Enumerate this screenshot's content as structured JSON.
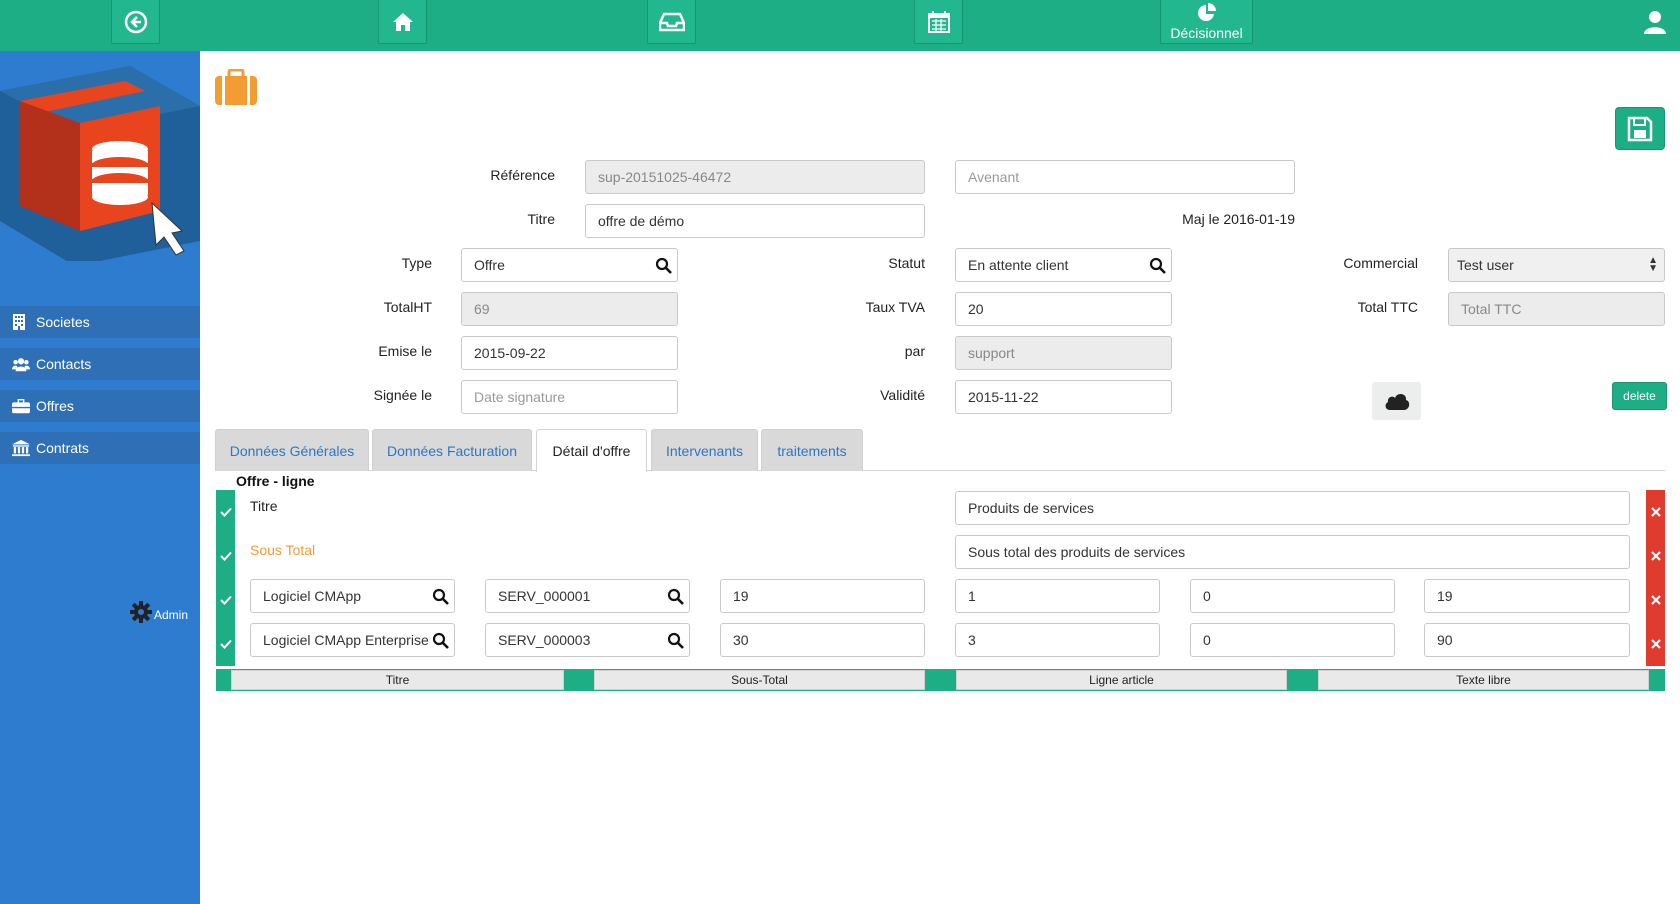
{
  "topbar": {
    "decisionnel_label": "Décisionnel"
  },
  "sidebar": {
    "items": [
      {
        "label": "Societes",
        "icon": "building-icon"
      },
      {
        "label": "Contacts",
        "icon": "users-icon"
      },
      {
        "label": "Offres",
        "icon": "briefcase-icon"
      },
      {
        "label": "Contrats",
        "icon": "bank-icon"
      }
    ],
    "admin_label": "Admin"
  },
  "form": {
    "reference": {
      "label": "Référence",
      "value": "sup-20151025-46472"
    },
    "avenant": {
      "placeholder": "Avenant"
    },
    "titre": {
      "label": "Titre",
      "value": "offre de démo"
    },
    "maj": "Maj le 2016-01-19",
    "type": {
      "label": "Type",
      "value": "Offre"
    },
    "statut": {
      "label": "Statut",
      "value": "En attente client"
    },
    "commercial": {
      "label": "Commercial",
      "value": "Test user"
    },
    "total_ht": {
      "label": "TotalHT",
      "value": "69"
    },
    "taux_tva": {
      "label": "Taux TVA",
      "value": "20"
    },
    "total_ttc": {
      "label": "Total TTC",
      "placeholder": "Total TTC"
    },
    "emise_le": {
      "label": "Emise le",
      "value": "2015-09-22"
    },
    "par": {
      "label": "par",
      "value": "support"
    },
    "signee_le": {
      "label": "Signée le",
      "placeholder": "Date signature"
    },
    "validite": {
      "label": "Validité",
      "value": "2015-11-22"
    },
    "delete_label": "delete"
  },
  "tabs": [
    {
      "label": "Données Générales"
    },
    {
      "label": "Données Facturation"
    },
    {
      "label": "Détail d'offre"
    },
    {
      "label": "Intervenants"
    },
    {
      "label": "traitements"
    }
  ],
  "detail": {
    "section_title": "Offre - ligne",
    "row_titre": {
      "label": "Titre",
      "value": "Produits de services"
    },
    "row_sous_total": {
      "label": "Sous Total",
      "value": "Sous total des produits de services"
    },
    "articles": [
      {
        "name": "Logiciel CMApp",
        "code": "SERV_000001",
        "price": "19",
        "qty": "1",
        "discount": "0",
        "total": "19"
      },
      {
        "name": "Logiciel CMApp Enterprise",
        "code": "SERV_000003",
        "price": "30",
        "qty": "3",
        "discount": "0",
        "total": "90"
      }
    ],
    "footer_buttons": [
      "Titre",
      "Sous-Total",
      "Ligne article",
      "Texte libre"
    ]
  },
  "colors": {
    "accent": "#1eae86",
    "sidebar": "#2d7ccf",
    "danger": "#e03b2f",
    "orange": "#f39c34"
  }
}
